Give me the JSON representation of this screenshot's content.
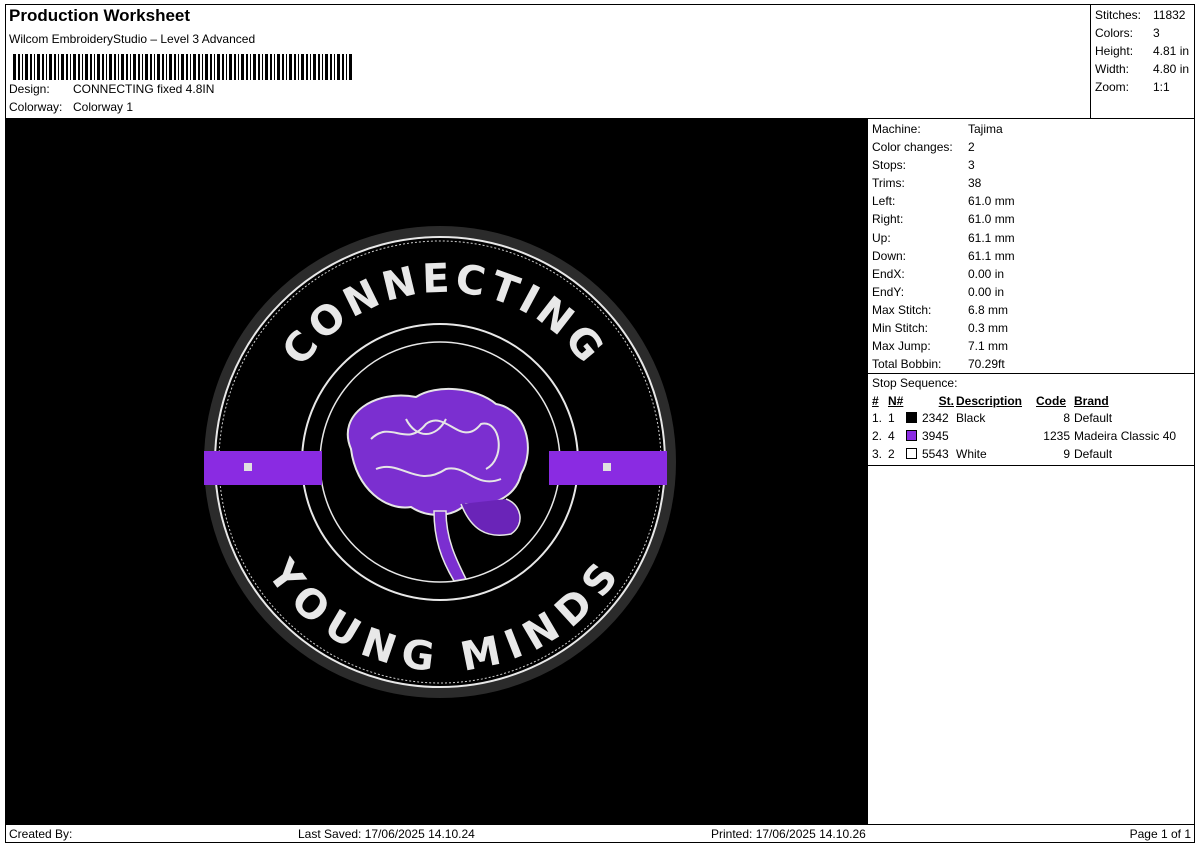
{
  "header": {
    "title": "Production Worksheet",
    "software": "Wilcom EmbroideryStudio – Level 3 Advanced",
    "design_label": "Design:",
    "design_value": "CONNECTING fixed 4.8IN",
    "colorway_label": "Colorway:",
    "colorway_value": "Colorway 1"
  },
  "stats": [
    {
      "k": "Stitches:",
      "v": "11832"
    },
    {
      "k": "Colors:",
      "v": "3"
    },
    {
      "k": "Height:",
      "v": "4.81 in"
    },
    {
      "k": "Width:",
      "v": "4.80 in"
    },
    {
      "k": "Zoom:",
      "v": "1:1"
    }
  ],
  "specs": [
    {
      "k": "Machine:",
      "v": "Tajima"
    },
    {
      "k": "Color changes:",
      "v": "2"
    },
    {
      "k": "Stops:",
      "v": "3"
    },
    {
      "k": "Trims:",
      "v": "38"
    },
    {
      "k": "Left:",
      "v": "61.0 mm"
    },
    {
      "k": "Right:",
      "v": "61.0 mm"
    },
    {
      "k": "Up:",
      "v": "61.1 mm"
    },
    {
      "k": "Down:",
      "v": "61.1 mm"
    },
    {
      "k": "EndX:",
      "v": "0.00 in"
    },
    {
      "k": "EndY:",
      "v": "0.00 in"
    },
    {
      "k": "Max Stitch:",
      "v": "6.8 mm"
    },
    {
      "k": "Min Stitch:",
      "v": "0.3 mm"
    },
    {
      "k": "Max Jump:",
      "v": "7.1 mm"
    },
    {
      "k": "Total Bobbin:",
      "v": "70.29ft"
    }
  ],
  "stop_sequence": {
    "title": "Stop Sequence:",
    "columns": [
      "#",
      "N#",
      "St.",
      "Description",
      "Code",
      "Brand"
    ],
    "rows": [
      {
        "num": "1.",
        "n": "1",
        "color": "#000000",
        "st": "2342",
        "desc": "Black",
        "code": "8",
        "brand": "Default"
      },
      {
        "num": "2.",
        "n": "4",
        "color": "#8a2be2",
        "st": "3945",
        "desc": "",
        "code": "1235",
        "brand": "Madeira Classic 40"
      },
      {
        "num": "3.",
        "n": "2",
        "color": "#ffffff",
        "st": "5543",
        "desc": "White",
        "code": "9",
        "brand": "Default"
      }
    ]
  },
  "design_image": {
    "text_top": "CONNECTING",
    "text_bottom": "YOUNG MINDS",
    "accent_color": "#8a2be2"
  },
  "footer": {
    "created_by": "Created By:",
    "last_saved": "Last Saved: 17/06/2025 14.10.24",
    "printed": "Printed: 17/06/2025 14.10.26",
    "page": "Page 1 of 1"
  }
}
